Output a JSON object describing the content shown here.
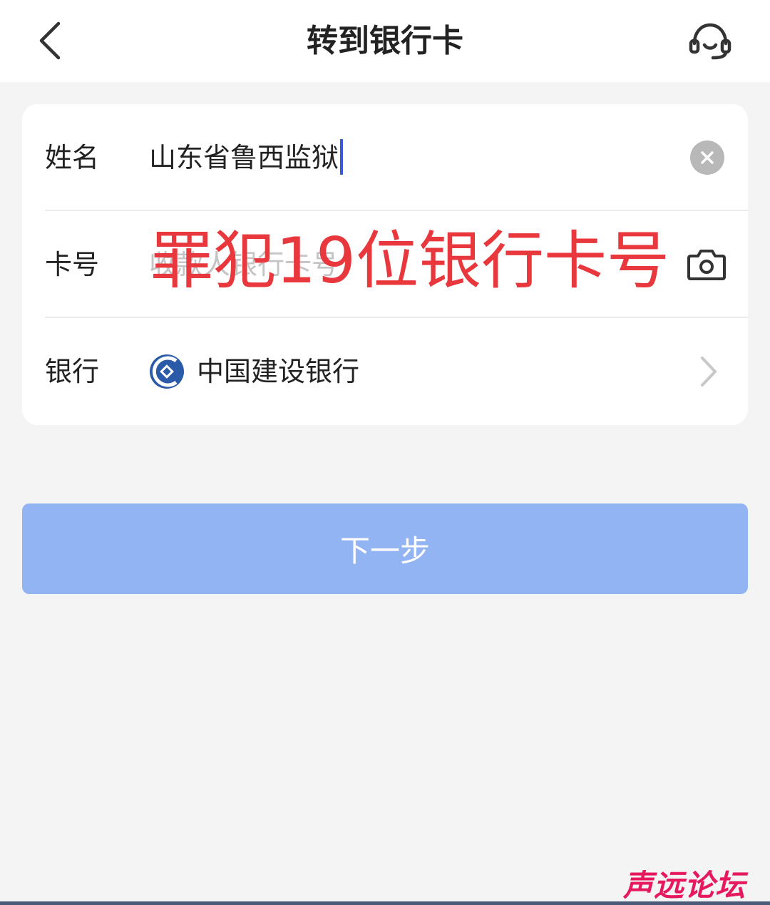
{
  "header": {
    "title": "转到银行卡",
    "back_icon": "chevron-left-icon",
    "support_icon": "headset-icon"
  },
  "form": {
    "name": {
      "label": "姓名",
      "value": "山东省鲁西监狱",
      "clear_icon": "clear-icon"
    },
    "card_number": {
      "label": "卡号",
      "placeholder": "收款人银行卡号",
      "value": "",
      "camera_icon": "camera-icon"
    },
    "bank": {
      "label": "银行",
      "value": "中国建设银行",
      "logo_icon": "ccb-logo-icon",
      "chevron_icon": "chevron-right-icon"
    }
  },
  "overlay_annotation": "罪犯19位银行卡号",
  "next_button": {
    "label": "下一步",
    "color": "#93b4f3"
  },
  "watermark": "声远论坛",
  "colors": {
    "accent": "#3a5bd9",
    "annotation": "#e8383d",
    "ccb_blue": "#2a5aa8",
    "watermark": "#e6195f"
  }
}
